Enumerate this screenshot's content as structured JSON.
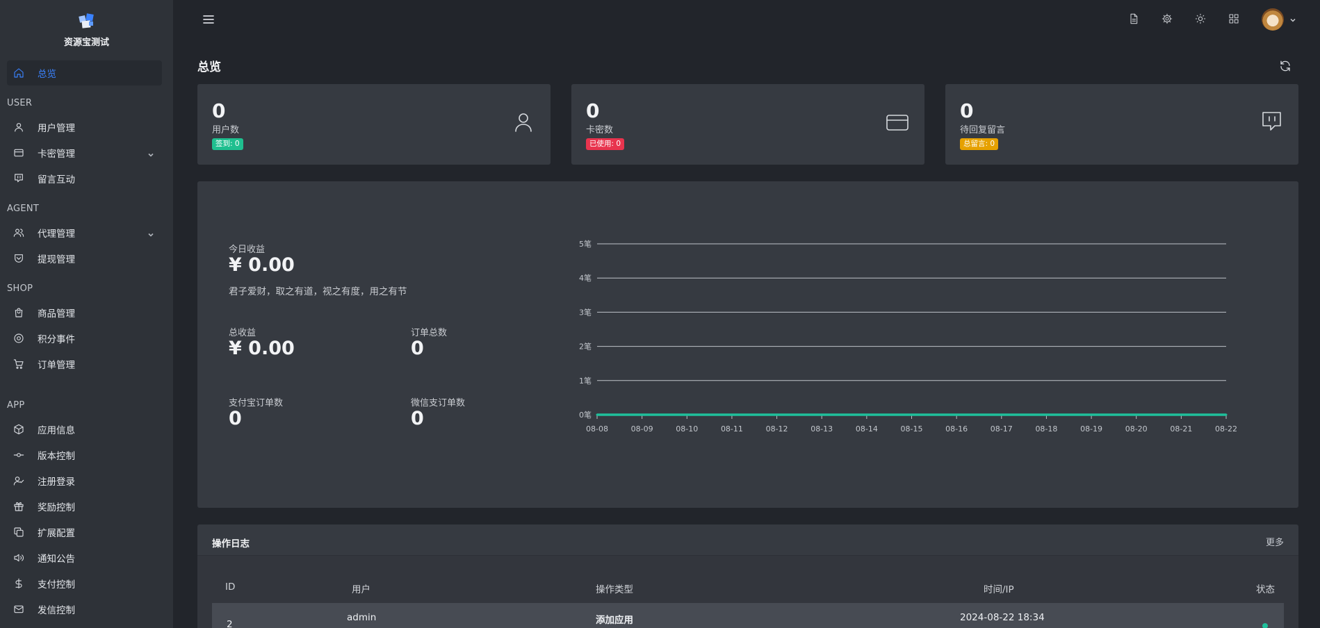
{
  "brand": {
    "title": "资源宝测试"
  },
  "sidebar": {
    "active": {
      "label": "总览",
      "icon": "home-icon"
    },
    "sections": [
      {
        "title": "USER",
        "items": [
          {
            "label": "用户管理",
            "icon": "user-icon"
          },
          {
            "label": "卡密管理",
            "icon": "card-icon",
            "expandable": true
          },
          {
            "label": "留言互动",
            "icon": "message-icon"
          }
        ]
      },
      {
        "title": "AGENT",
        "items": [
          {
            "label": "代理管理",
            "icon": "users-icon",
            "expandable": true
          },
          {
            "label": "提现管理",
            "icon": "wallet-icon"
          }
        ]
      },
      {
        "title": "SHOP",
        "items": [
          {
            "label": "商品管理",
            "icon": "bag-icon"
          },
          {
            "label": "积分事件",
            "icon": "target-icon"
          },
          {
            "label": "订单管理",
            "icon": "cart-icon"
          }
        ]
      },
      {
        "title": "APP",
        "items": [
          {
            "label": "应用信息",
            "icon": "box-icon"
          },
          {
            "label": "版本控制",
            "icon": "commit-icon"
          },
          {
            "label": "注册登录",
            "icon": "user-check-icon"
          },
          {
            "label": "奖励控制",
            "icon": "gift-icon"
          },
          {
            "label": "扩展配置",
            "icon": "copy-icon"
          },
          {
            "label": "通知公告",
            "icon": "speaker-icon"
          },
          {
            "label": "支付控制",
            "icon": "dollar-icon"
          },
          {
            "label": "发信控制",
            "icon": "mail-icon"
          }
        ]
      }
    ]
  },
  "topbar": {
    "icons": [
      "document-icon",
      "settings-icon",
      "sun-icon",
      "grid-icon"
    ]
  },
  "page": {
    "title": "总览"
  },
  "stats": [
    {
      "value": "0",
      "label": "用户数",
      "badge": "签到: 0",
      "badge_color": "#1fbf8f",
      "icon": "user-icon"
    },
    {
      "value": "0",
      "label": "卡密数",
      "badge": "已使用: 0",
      "badge_color": "#e8344e",
      "icon": "card-icon"
    },
    {
      "value": "0",
      "label": "待回复留言",
      "badge": "总留言: 0",
      "badge_color": "#e6a100",
      "icon": "message-icon"
    }
  ],
  "revenue": {
    "today_label": "今日收益",
    "today_value": "¥ 0.00",
    "motto": "君子爱财，取之有道，视之有度，用之有节",
    "total_label": "总收益",
    "total_value": "¥ 0.00",
    "orders_label": "订单总数",
    "orders_value": "0",
    "alipay_label": "支付宝订单数",
    "alipay_value": "0",
    "wechat_label": "微信支订单数",
    "wechat_value": "0"
  },
  "chart_data": {
    "type": "line",
    "categories": [
      "08-08",
      "08-09",
      "08-10",
      "08-11",
      "08-12",
      "08-13",
      "08-14",
      "08-15",
      "08-16",
      "08-17",
      "08-18",
      "08-19",
      "08-20",
      "08-21",
      "08-22"
    ],
    "series": [
      {
        "values": [
          0,
          0,
          0,
          0,
          0,
          0,
          0,
          0,
          0,
          0,
          0,
          0,
          0,
          0,
          0
        ]
      }
    ],
    "y_ticks": [
      "0笔",
      "1笔",
      "2笔",
      "3笔",
      "4笔",
      "5笔"
    ],
    "ylim": [
      0,
      5
    ],
    "grid": true,
    "line_color": "#1fc09b"
  },
  "log": {
    "title": "操作日志",
    "more": "更多",
    "columns": [
      "ID",
      "用户",
      "操作类型",
      "时间/IP",
      "状态"
    ],
    "rows": [
      {
        "id": "2",
        "user": "admin",
        "action": "添加应用",
        "time": "2024-08-22 18:34"
      }
    ]
  }
}
